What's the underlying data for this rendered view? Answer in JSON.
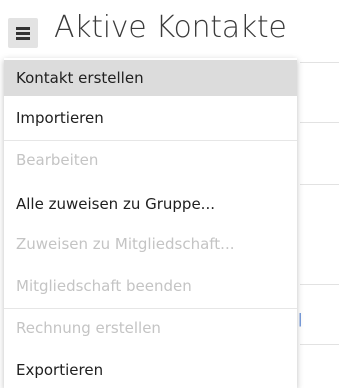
{
  "header": {
    "title": "Aktive Kontakte",
    "menu_icon": "hamburger-menu-icon"
  },
  "dropdown": {
    "items": [
      {
        "label": "Kontakt erstellen",
        "state": "hover"
      },
      {
        "label": "Importieren",
        "state": "enabled"
      },
      {
        "label": "Bearbeiten",
        "state": "disabled"
      },
      {
        "label": "Alle zuweisen zu Gruppe...",
        "state": "enabled"
      },
      {
        "label": "Zuweisen zu Mitgliedschaft...",
        "state": "disabled"
      },
      {
        "label": "Mitgliedschaft beenden",
        "state": "disabled"
      },
      {
        "label": "Rechnung erstellen",
        "state": "disabled"
      },
      {
        "label": "Exportieren",
        "state": "enabled"
      }
    ]
  },
  "colors": {
    "hover_background": "#dcdcdc",
    "disabled_text": "#c4c4c4",
    "enabled_text": "#202020",
    "title_text": "#3a3a3a",
    "menu_button_background": "#e3e3e3"
  }
}
